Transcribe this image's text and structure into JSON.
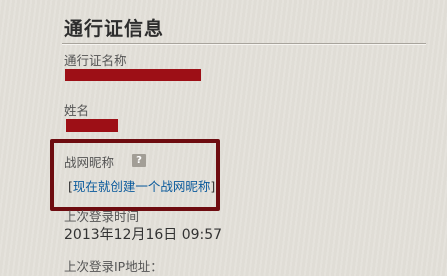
{
  "section": {
    "title": "通行证信息"
  },
  "account_name": {
    "label": "通行证名称"
  },
  "name": {
    "label": "姓名"
  },
  "battletag": {
    "label": "战网昵称",
    "help_icon_glyph": "?",
    "link_open": "[",
    "link_text": "现在就创建一个战网昵称",
    "link_close": "]"
  },
  "last_login": {
    "label": "上次登录时间",
    "value": "2013年12月16日 09:57"
  },
  "last_ip": {
    "label": "上次登录IP地址："
  },
  "colors": {
    "redaction": "#9d0f16",
    "highlight_border": "#6e0c10",
    "link": "#0a5a9c"
  }
}
